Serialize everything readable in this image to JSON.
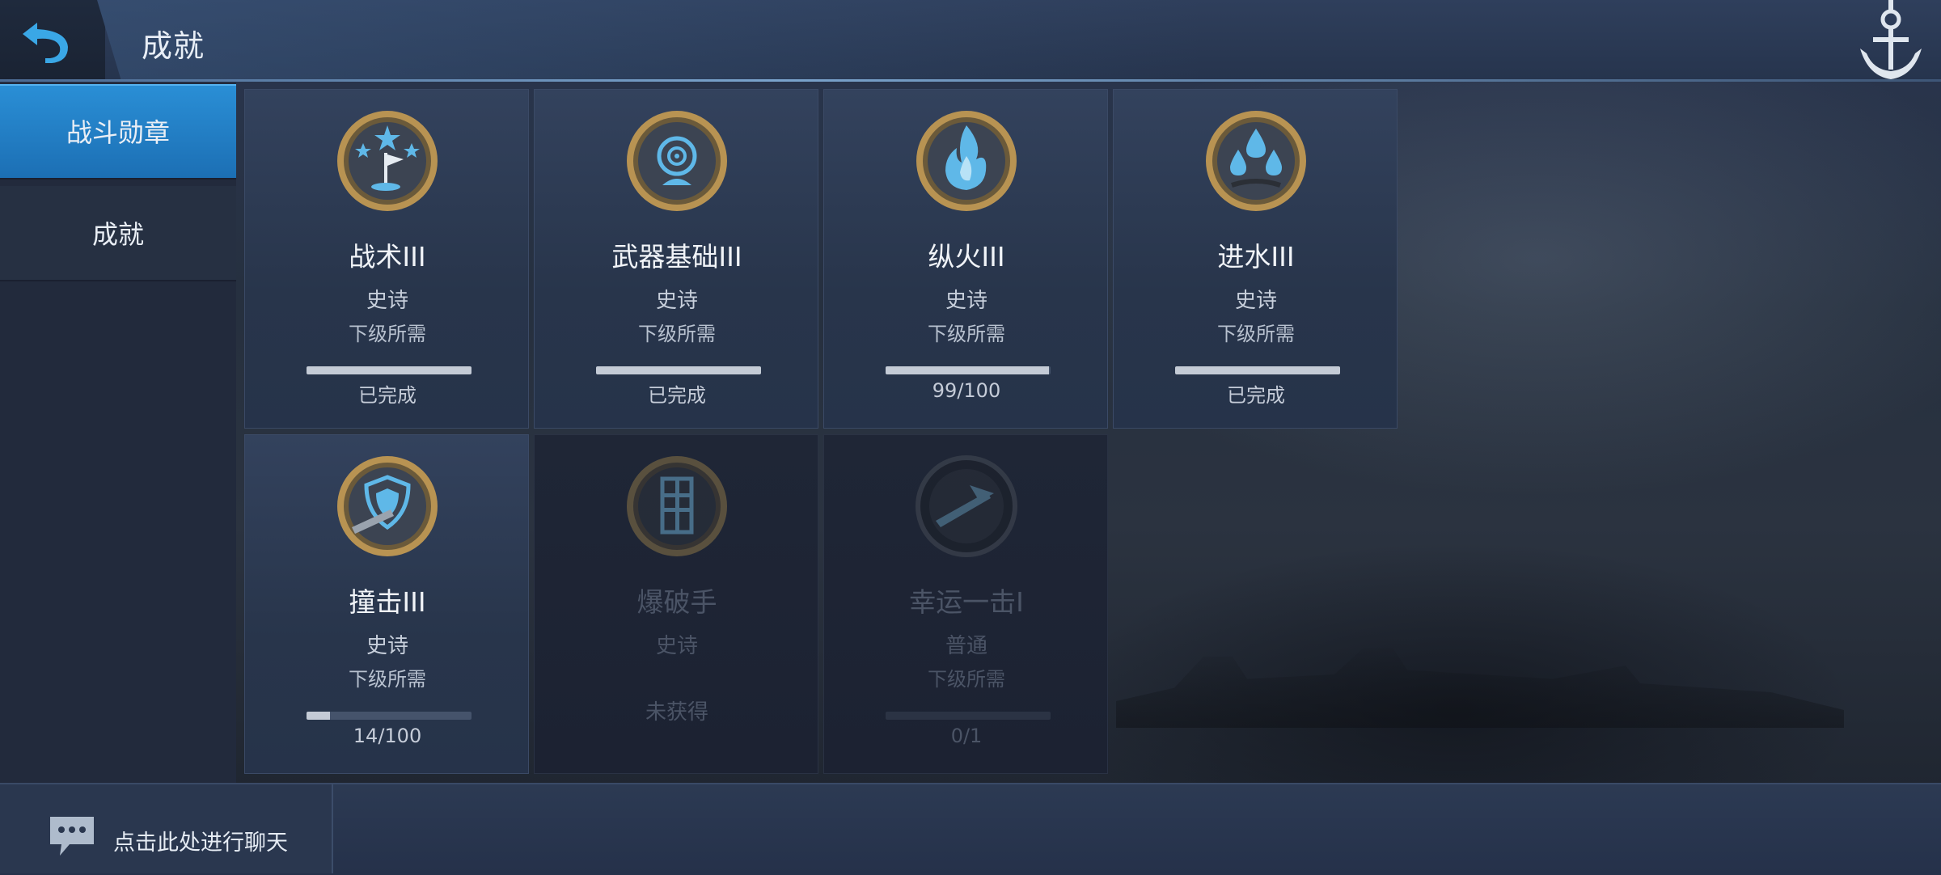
{
  "header": {
    "title": "成就",
    "back_icon": "back-arrow-icon",
    "anchor_icon": "anchor-icon"
  },
  "sidebar": {
    "items": [
      {
        "label": "战斗勋章",
        "active": true
      },
      {
        "label": "成就",
        "active": false
      }
    ]
  },
  "medals": [
    {
      "name": "战术III",
      "rarity": "史诗",
      "next_label": "下级所需",
      "progress_text": "已完成",
      "progress": 1.0,
      "icon": "flag-stars-medal-icon",
      "locked": false
    },
    {
      "name": "武器基础III",
      "rarity": "史诗",
      "next_label": "下级所需",
      "progress_text": "已完成",
      "progress": 1.0,
      "icon": "target-medal-icon",
      "locked": false
    },
    {
      "name": "纵火III",
      "rarity": "史诗",
      "next_label": "下级所需",
      "progress_text": "99/100",
      "progress": 0.99,
      "icon": "fire-medal-icon",
      "locked": false
    },
    {
      "name": "进水III",
      "rarity": "史诗",
      "next_label": "下级所需",
      "progress_text": "已完成",
      "progress": 1.0,
      "icon": "water-drops-medal-icon",
      "locked": false
    },
    {
      "name": "撞击III",
      "rarity": "史诗",
      "next_label": "下级所需",
      "progress_text": "14/100",
      "progress": 0.14,
      "icon": "ram-shield-medal-icon",
      "locked": false
    },
    {
      "name": "爆破手",
      "rarity": "史诗",
      "next_label": "",
      "progress_text": "未获得",
      "progress": 0,
      "icon": "torpedo-medal-icon",
      "locked": true
    },
    {
      "name": "幸运一击I",
      "rarity": "普通",
      "next_label": "下级所需",
      "progress_text": "0/1",
      "progress": 0,
      "icon": "lucky-strike-medal-icon",
      "locked": true
    }
  ],
  "chat": {
    "placeholder": "点击此处进行聊天",
    "icon": "chat-bubble-icon"
  },
  "colors": {
    "accent": "#2a8fd6",
    "gold": "#c9a35a",
    "medal_blue": "#5fb8e8"
  }
}
